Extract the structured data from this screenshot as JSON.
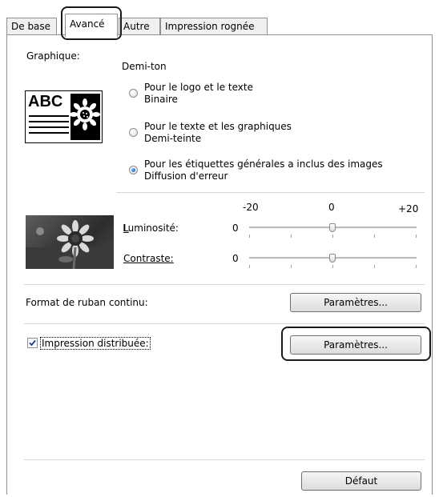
{
  "tabs": [
    {
      "label": "De base"
    },
    {
      "label": "Avancé"
    },
    {
      "label": "Autre"
    },
    {
      "label": "Impression rognée"
    }
  ],
  "graphics": {
    "label": "Graphique:",
    "halftone_label": "Demi-ton",
    "options": [
      {
        "line1": "Pour le logo et le texte",
        "line2": "Binaire",
        "checked": false
      },
      {
        "line1": "Pour le texte et les graphiques",
        "line2": "Demi-teinte",
        "checked": false
      },
      {
        "line1": "Pour les étiquettes générales a inclus des images",
        "line2": "Diffusion d'erreur",
        "checked": true
      }
    ],
    "preview_text": "ABC"
  },
  "adjust": {
    "scale_min": "-20",
    "scale_mid": "0",
    "scale_max": "+20",
    "brightness": {
      "label": "Luminosité:",
      "value": "0"
    },
    "contrast": {
      "label": "Contraste:",
      "value": "0"
    }
  },
  "continuous_tape": {
    "label": "Format de ruban continu:",
    "button": "Paramètres..."
  },
  "distributed_print": {
    "label": "Impression distribuée:",
    "checked": true,
    "button": "Paramètres..."
  },
  "default_button": "Défaut"
}
